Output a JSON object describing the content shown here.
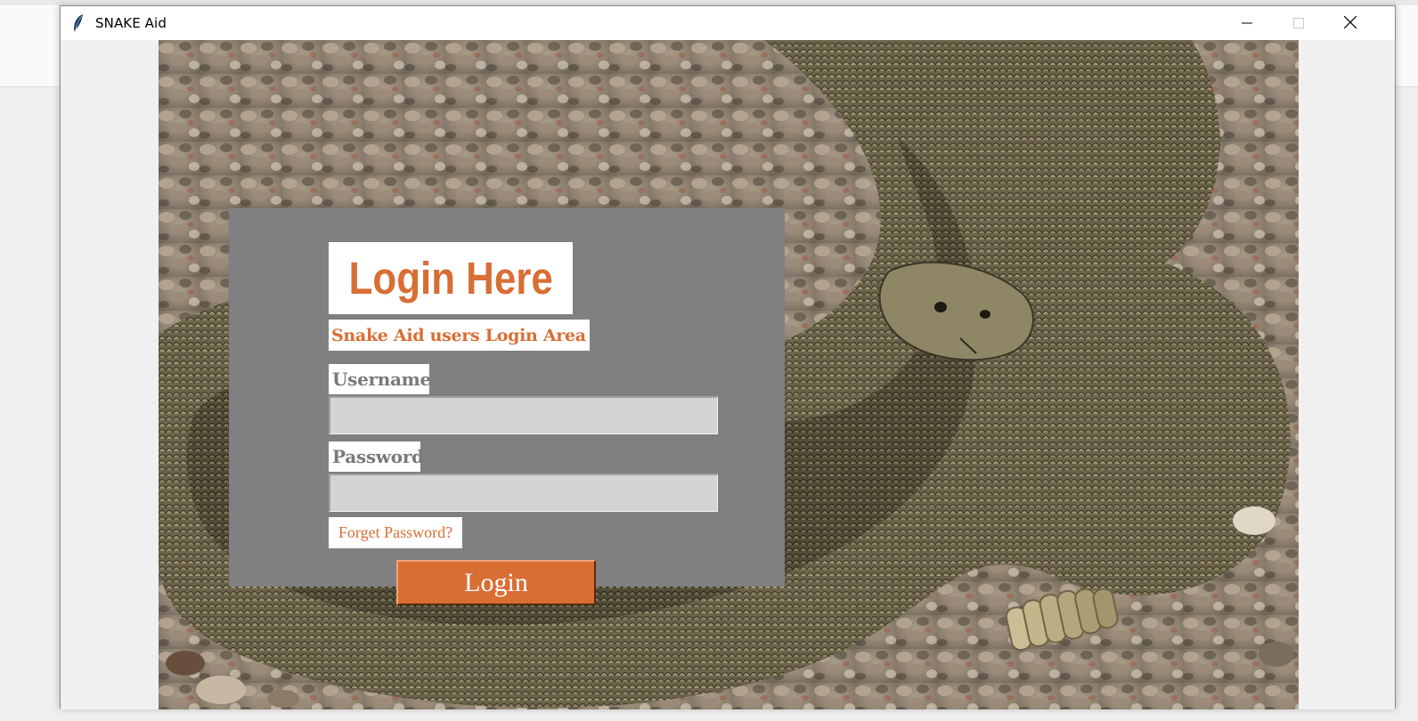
{
  "window": {
    "title": "SNAKE Aid",
    "controls": {
      "minimize_icon": "minimize-icon",
      "maximize_icon": "maximize-icon",
      "close_icon": "close-icon"
    }
  },
  "background_image": {
    "icon": "rattlesnake-photo"
  },
  "login": {
    "heading": "Login Here",
    "subheading": "Snake Aid users Login Area",
    "username_label": "Username",
    "username_value": "",
    "password_label": "Password",
    "password_value": "",
    "forgot_link": "Forget Password?",
    "submit_label": "Login"
  },
  "colors": {
    "accent": "#d96e35",
    "panel": "#808080",
    "field": "#d4d4d4",
    "label": "#7a7a7a"
  }
}
